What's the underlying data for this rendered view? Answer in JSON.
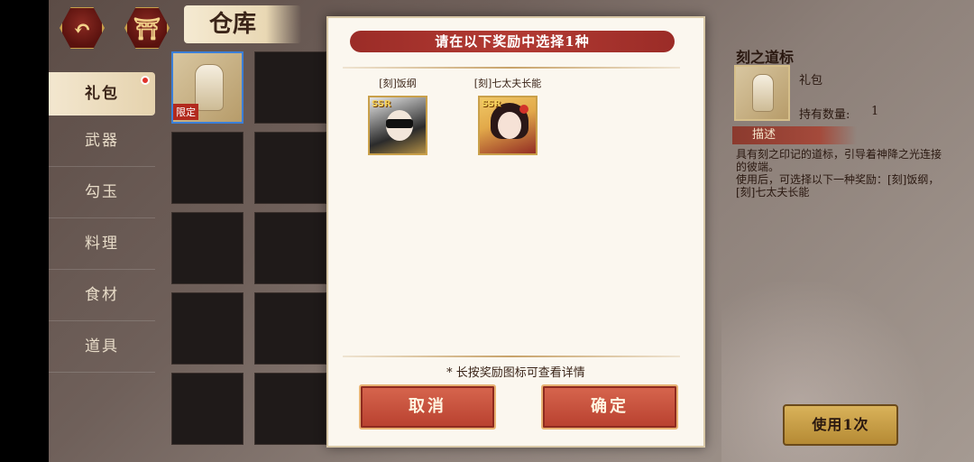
{
  "header": {
    "title": "仓库",
    "back_icon": "↶",
    "home_icon": "⛩"
  },
  "sidebar": {
    "items": [
      {
        "label": "礼包",
        "active": true,
        "badge": true
      },
      {
        "label": "武器"
      },
      {
        "label": "勾玉"
      },
      {
        "label": "料理"
      },
      {
        "label": "食材"
      },
      {
        "label": "道具"
      }
    ]
  },
  "inventory": {
    "selected_item": {
      "tag": "限定"
    }
  },
  "dialog": {
    "title": "请在以下奖励中选择1种",
    "rewards": [
      {
        "name": "[刻]饭纲",
        "rarity": "SSR"
      },
      {
        "name": "[刻]七太夫长能",
        "rarity": "SSR"
      }
    ],
    "hint": "* 长按奖励图标可查看详情",
    "cancel_label": "取消",
    "confirm_label": "确定"
  },
  "detail": {
    "title": "刻之道标",
    "type": "礼包",
    "qty_label": "持有数量:",
    "qty_value": "1",
    "desc_heading": "描述",
    "desc_line1": "具有刻之印记的道标，引导着神降之光连接的彼端。",
    "desc_line2": "使用后，可选择以下一种奖励：[刻]饭纲，[刻]七太夫长能",
    "use_label": "使用1次"
  },
  "colors": {
    "accent_red": "#9b2c27",
    "gold": "#c9a04a",
    "selected_border": "#3b7fd8"
  }
}
